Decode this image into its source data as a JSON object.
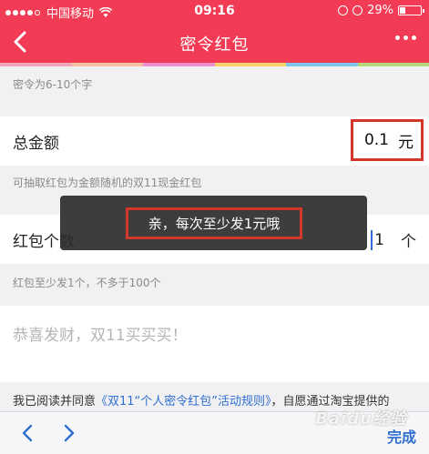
{
  "status_bar": {
    "carrier": "中国移动",
    "time": "09:16",
    "battery": "29%",
    "battery_level": 0.29,
    "signal_icon": "signal-dots-icon",
    "wifi_icon": "wifi-icon"
  },
  "nav": {
    "title": "密令红包",
    "back_icon": "chevron-left-icon",
    "more_icon": "more-dots-icon"
  },
  "colors": {
    "brand": "#f23c55",
    "highlight_border": "#d3372c",
    "link": "#2f6fd0",
    "strip": [
      "#f6a5b8",
      "#f7c1a2",
      "#f08dcf",
      "#f9d16b",
      "#7cc6ee",
      "#b6d97a"
    ]
  },
  "form": {
    "password_hint": "密令为6-10个字",
    "total_amount_label": "总金额",
    "total_amount_value": "0.1",
    "total_amount_unit": "元",
    "amount_hint": "可抽取红包为金额随机的双11现金红包",
    "count_label": "红包个数",
    "count_value": "1",
    "count_unit": "个",
    "count_hint": "红包至少发1个，不多于100个",
    "greeting_placeholder": "恭喜发财，双11买买买！",
    "agreement_prefix": "我已阅读并同意",
    "agreement_link": "《双11“个人密令红包”活动规则》",
    "agreement_suffix": "，自愿通过淘宝提供的"
  },
  "toast": {
    "message": "亲，每次至少发1元哦"
  },
  "toolbar": {
    "prev_icon": "chevron-left-icon",
    "next_icon": "chevron-right-icon",
    "done_label": "完成"
  },
  "watermark": "Baidu经验"
}
